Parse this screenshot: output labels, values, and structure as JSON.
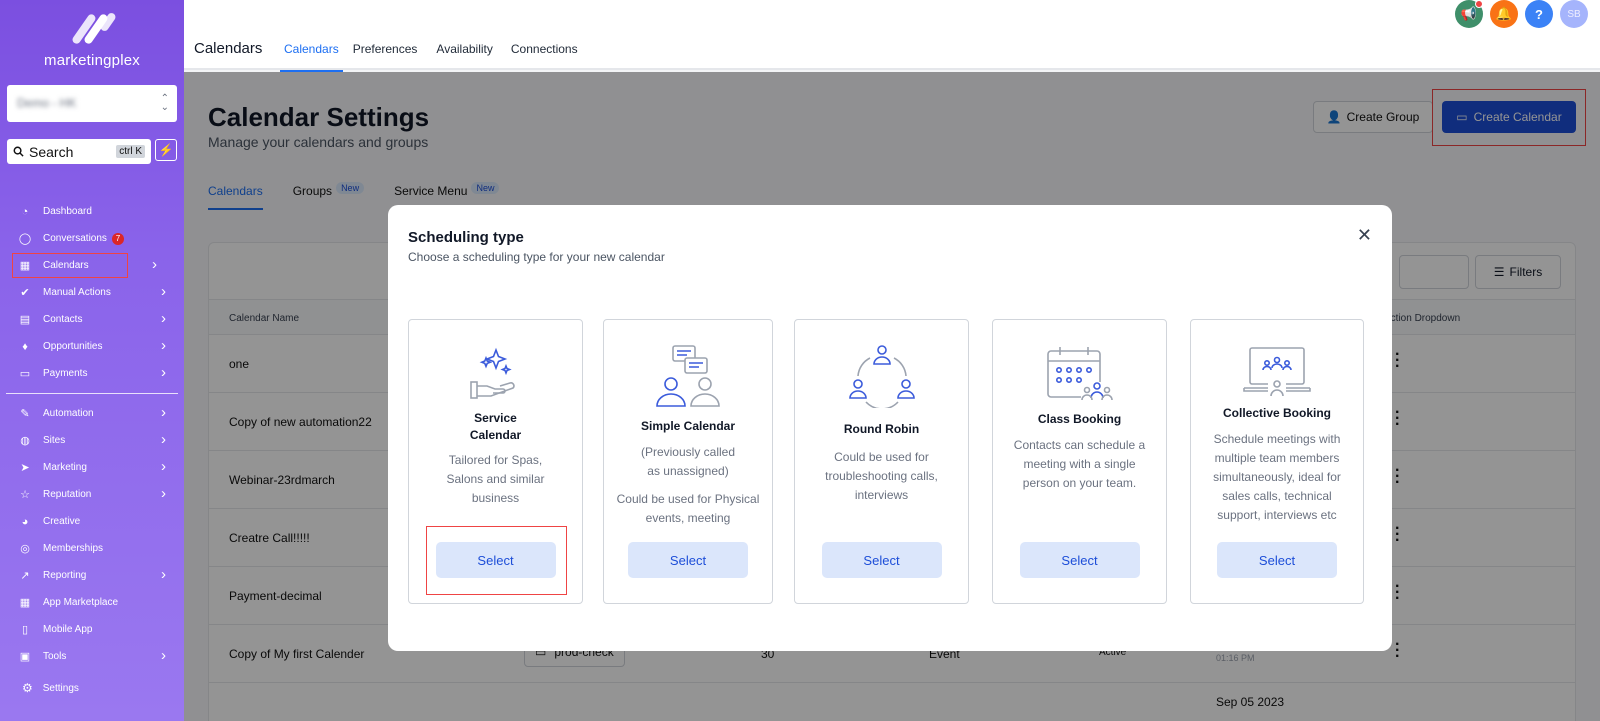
{
  "sidebar": {
    "logo_text": "marketingplex",
    "account_value": "Demo - HK",
    "search_label": "Search",
    "search_kbd": "ctrl K",
    "items": [
      {
        "label": "Dashboard",
        "icon": "gauge-icon",
        "chev": false
      },
      {
        "label": "Conversations",
        "icon": "chat-icon",
        "chev": false,
        "badge": "7"
      },
      {
        "label": "Calendars",
        "icon": "calendar-icon",
        "chev": true,
        "active": true
      },
      {
        "label": "Manual Actions",
        "icon": "check-circle-icon",
        "chev": true
      },
      {
        "label": "Contacts",
        "icon": "contacts-icon",
        "chev": true
      },
      {
        "label": "Opportunities",
        "icon": "funnel-icon",
        "chev": true
      },
      {
        "label": "Payments",
        "icon": "card-icon",
        "chev": true
      }
    ],
    "items2": [
      {
        "label": "Automation",
        "icon": "wand-icon",
        "chev": true
      },
      {
        "label": "Sites",
        "icon": "globe-icon",
        "chev": true
      },
      {
        "label": "Marketing",
        "icon": "send-icon",
        "chev": true
      },
      {
        "label": "Reputation",
        "icon": "star-icon",
        "chev": true
      },
      {
        "label": "Creative",
        "icon": "palette-icon",
        "chev": false
      },
      {
        "label": "Memberships",
        "icon": "graduation-icon",
        "chev": false
      },
      {
        "label": "Reporting",
        "icon": "chart-icon",
        "chev": true
      },
      {
        "label": "App Marketplace",
        "icon": "grid-icon",
        "chev": false
      },
      {
        "label": "Mobile App",
        "icon": "phone-icon",
        "chev": false
      },
      {
        "label": "Tools",
        "icon": "toolbox-icon",
        "chev": true
      }
    ],
    "settings_label": "Settings"
  },
  "topbar": {
    "title": "Calendars",
    "tabs": [
      "Calendars",
      "Preferences",
      "Availability",
      "Connections"
    ],
    "avatar_initials": "SB"
  },
  "main": {
    "title": "Calendar Settings",
    "subtitle": "Manage your calendars and groups",
    "create_group": "Create Group",
    "create_calendar": "Create Calendar",
    "subtabs": [
      {
        "label": "Calendars",
        "new": false
      },
      {
        "label": "Groups",
        "new": true
      },
      {
        "label": "Service Menu",
        "new": true
      }
    ],
    "new_label": "New",
    "filters": "Filters",
    "col_name": "Calendar Name",
    "col_action": "Action Dropdown",
    "rows": [
      {
        "name": "one"
      },
      {
        "name": "Copy of new automation22"
      },
      {
        "name": "Webinar-23rdmarch"
      },
      {
        "name": "Creatre Call!!!!!"
      },
      {
        "name": "Payment-decimal"
      },
      {
        "name": "Copy of My first Calender",
        "group": "prod-check",
        "duration": "30",
        "type": "Event",
        "status": "Active",
        "date": "Sep 05 2023",
        "time": "01:16 PM"
      }
    ],
    "partial_date": "Sep 05 2023"
  },
  "modal": {
    "title": "Scheduling type",
    "subtitle": "Choose a scheduling type for your new calendar",
    "select_label": "Select",
    "options": [
      {
        "name": "Service\nCalendar",
        "desc": "Tailored for Spas, Salons and similar business"
      },
      {
        "name": "Simple Calendar",
        "desc1": "(Previously called as unassigned)",
        "desc": "Could be used for Physical events, meeting"
      },
      {
        "name": "Round Robin",
        "desc": "Could be used for troubleshooting calls, interviews"
      },
      {
        "name": "Class Booking",
        "desc": "Contacts can schedule a meeting with a single person on your team."
      },
      {
        "name": "Collective Booking",
        "desc": "Schedule meetings with multiple team members simultaneously, ideal for sales calls, technical support, interviews etc"
      }
    ]
  },
  "colors": {
    "accent": "#1d4ed8",
    "sidebar_top": "#7b4fe0",
    "highlight": "#ef4444",
    "icon_blue": "#3b5bdb"
  }
}
